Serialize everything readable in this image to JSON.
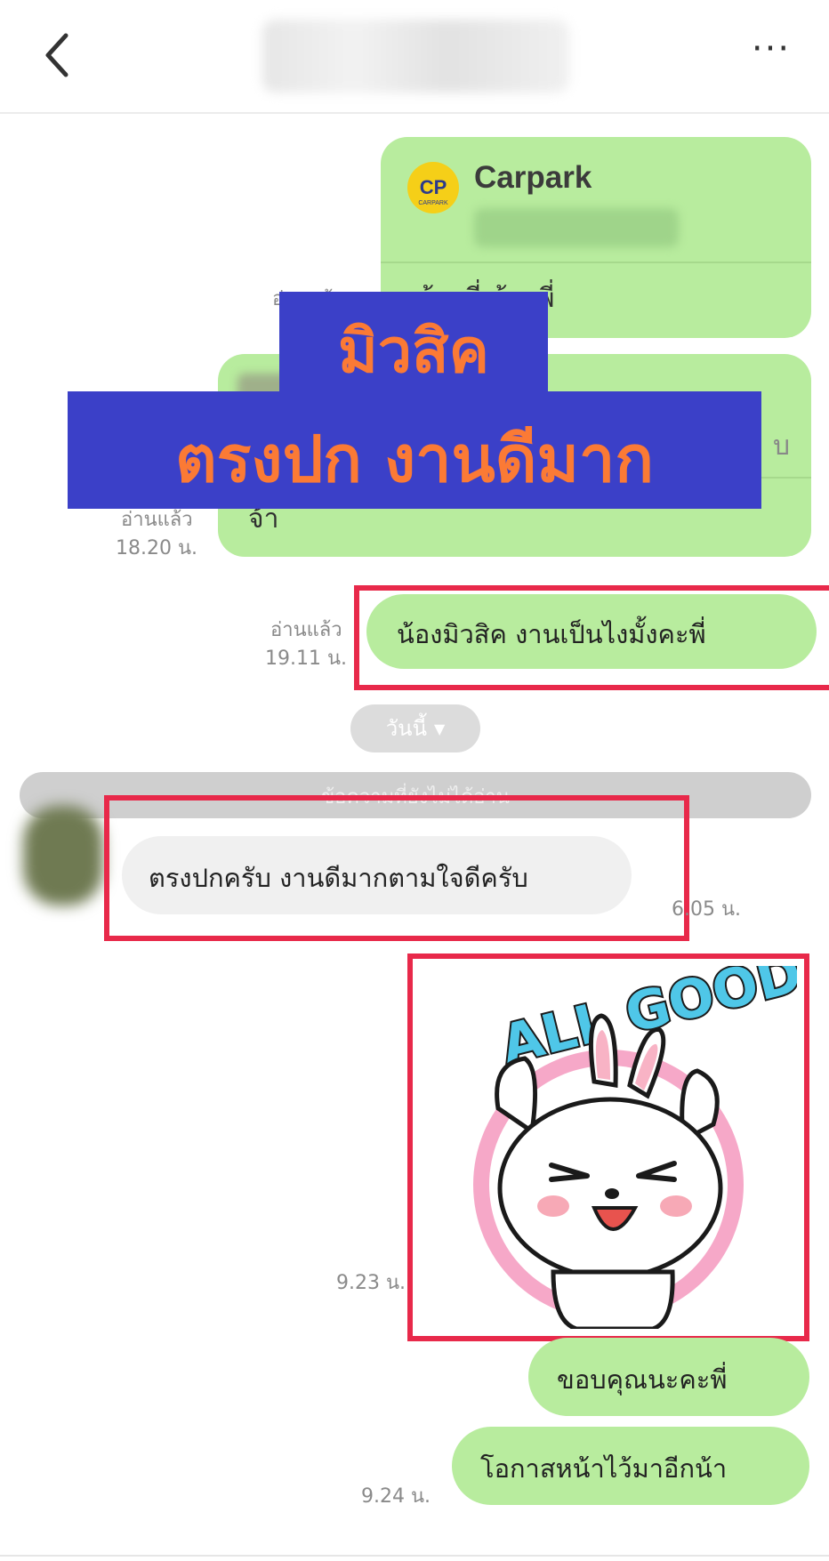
{
  "header": {
    "back_icon": "chevron-left-icon",
    "title": "",
    "more_label": "···"
  },
  "messages": {
    "card1": {
      "name": "Carpark",
      "text": "น้องพี่ น้องพี่"
    },
    "card1_read": "อ่านแล้ว",
    "card2": {
      "text": "จ้า",
      "side": "บ"
    },
    "card2_read": "อ่านแล้ว",
    "card2_time": "18.20 น.",
    "question": {
      "text": "น้องมิวสิค งานเป็นไงมั้งคะพี่",
      "read": "อ่านแล้ว",
      "time": "19.11 น."
    },
    "today_pill": {
      "label": "วันนี้",
      "caret": "▼"
    },
    "unread_bar": "ข้อความที่ยังไม่ได้อ่าน",
    "reply": {
      "text": "ตรงปกครับ งานดีมากตามใจดีครับ",
      "time": "6.05 น."
    },
    "sticker": {
      "text": "ALL GOOD!",
      "time": "9.23 น."
    },
    "thanks": {
      "text": "ขอบคุณนะคะพี่"
    },
    "next": {
      "text": "โอกาสหน้าไว้มาอีกน้า",
      "time": "9.24 น."
    }
  },
  "banner": {
    "line1": "มิวสิค",
    "line2": "ตรงปก งานดีมาก"
  },
  "colors": {
    "sent_bubble": "#b8ec9e",
    "received_bubble": "#f0f0f0",
    "banner_bg": "#3b40c8",
    "banner_text": "#fb7a35",
    "highlight": "#e8294a"
  }
}
